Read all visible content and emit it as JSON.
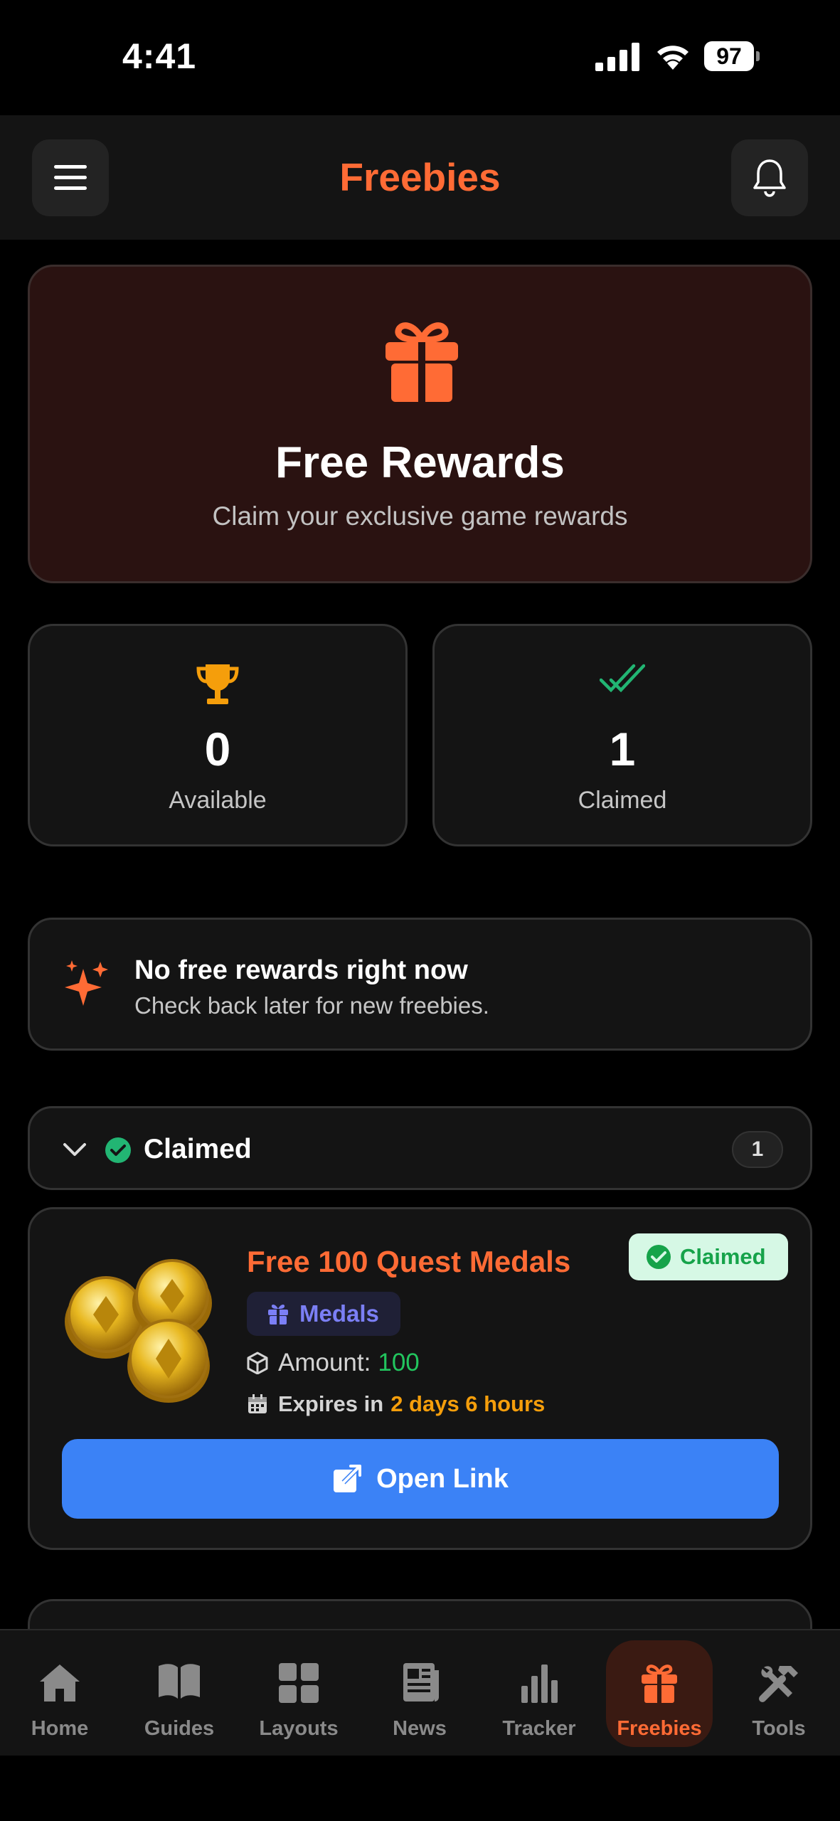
{
  "status_bar": {
    "time": "4:41",
    "battery": "97"
  },
  "header": {
    "title": "Freebies"
  },
  "hero": {
    "title": "Free Rewards",
    "subtitle": "Claim your exclusive game rewards"
  },
  "stats": [
    {
      "value": "0",
      "label": "Available"
    },
    {
      "value": "1",
      "label": "Claimed"
    }
  ],
  "notice": {
    "title": "No free rewards right now",
    "subtitle": "Check back later for new freebies."
  },
  "claimed_section": {
    "title": "Claimed",
    "count": "1"
  },
  "reward": {
    "title": "Free 100 Quest Medals",
    "status": "Claimed",
    "tag": "Medals",
    "amount_label": "Amount:",
    "amount_value": "100",
    "expires_label": "Expires in",
    "expires_value": "2 days 6 hours",
    "button_label": "Open Link"
  },
  "tabs": [
    {
      "label": "Home",
      "icon": "home-icon"
    },
    {
      "label": "Guides",
      "icon": "book-icon"
    },
    {
      "label": "Layouts",
      "icon": "grid-icon"
    },
    {
      "label": "News",
      "icon": "newspaper-icon"
    },
    {
      "label": "Tracker",
      "icon": "bar-chart-icon"
    },
    {
      "label": "Freebies",
      "icon": "gift-icon",
      "active": true
    },
    {
      "label": "Tools",
      "icon": "tools-icon"
    }
  ],
  "colors": {
    "accent": "#ff6b35",
    "primary_button": "#3b82f6",
    "success": "#22c55e",
    "warning": "#f59e0b",
    "tag": "#7b7ff5"
  }
}
